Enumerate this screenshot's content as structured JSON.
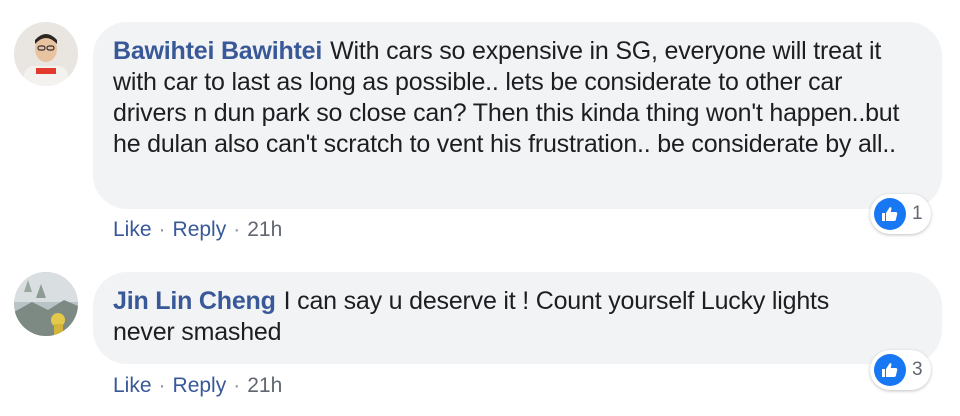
{
  "comments": [
    {
      "author": "Bawihtei Bawihtei",
      "text": "With cars so expensive in SG, everyone will treat it with car to last as long as possible.. lets be considerate to other car drivers n dun park so close can? Then this kinda thing won't happen..but he dulan also can't scratch to vent his frustration.. be considerate by all..",
      "actions": {
        "like": "Like",
        "reply": "Reply",
        "time": "21h",
        "separator": "·"
      },
      "reaction_count": "1",
      "reaction_icon": "thumbs-up-icon"
    },
    {
      "author": "Jin Lin Cheng",
      "text": "I can say u deserve it ! Count yourself Lucky lights never smashed",
      "actions": {
        "like": "Like",
        "reply": "Reply",
        "time": "21h",
        "separator": "·"
      },
      "reaction_count": "3",
      "reaction_icon": "thumbs-up-icon"
    }
  ],
  "colors": {
    "author_name": "#385898",
    "bubble_background": "#f2f3f5",
    "like_blue": "#1877f2",
    "meta_gray": "#606770"
  }
}
